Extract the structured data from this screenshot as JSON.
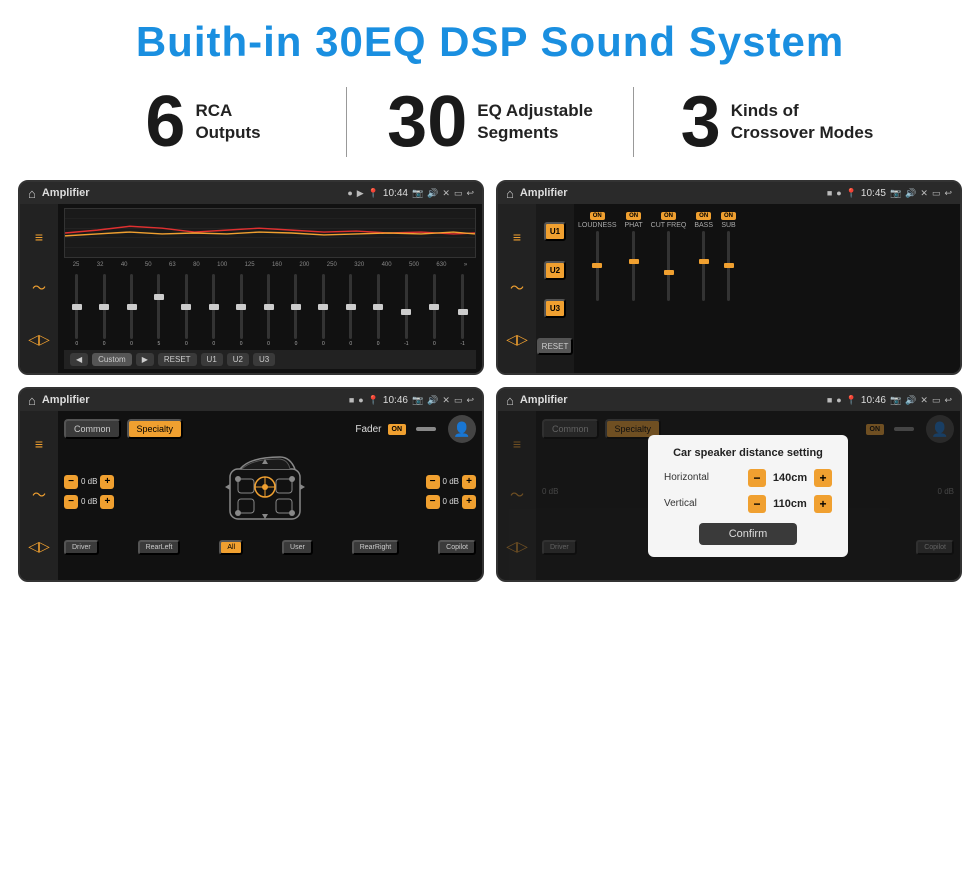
{
  "title": "Buith-in 30EQ DSP Sound System",
  "stats": [
    {
      "number": "6",
      "text": "RCA\nOutputs"
    },
    {
      "number": "30",
      "text": "EQ Adjustable\nSegments"
    },
    {
      "number": "3",
      "text": "Kinds of\nCrossover Modes"
    }
  ],
  "screens": [
    {
      "id": "eq-screen",
      "status_bar": {
        "title": "Amplifier",
        "time": "10:44"
      }
    },
    {
      "id": "amp-screen",
      "status_bar": {
        "title": "Amplifier",
        "time": "10:45"
      }
    },
    {
      "id": "fader-screen",
      "status_bar": {
        "title": "Amplifier",
        "time": "10:46"
      }
    },
    {
      "id": "dialog-screen",
      "status_bar": {
        "title": "Amplifier",
        "time": "10:46"
      },
      "dialog": {
        "title": "Car speaker distance setting",
        "horizontal_label": "Horizontal",
        "horizontal_value": "140cm",
        "vertical_label": "Vertical",
        "vertical_value": "110cm",
        "confirm_label": "Confirm"
      }
    }
  ],
  "eq_freqs": [
    "25",
    "32",
    "40",
    "50",
    "63",
    "80",
    "100",
    "125",
    "160",
    "200",
    "250",
    "320",
    "400",
    "500",
    "630"
  ],
  "eq_values": [
    "0",
    "0",
    "0",
    "5",
    "0",
    "0",
    "0",
    "0",
    "0",
    "0",
    "0",
    "0",
    "-1",
    "0",
    "-1"
  ],
  "amp_channels": [
    {
      "label": "LOUDNESS",
      "on": true
    },
    {
      "label": "PHAT",
      "on": true
    },
    {
      "label": "CUT FREQ",
      "on": true
    },
    {
      "label": "BASS",
      "on": true
    },
    {
      "label": "SUB",
      "on": true
    }
  ],
  "amp_presets": [
    "U1",
    "U2",
    "U3"
  ],
  "fader_tabs": [
    "Common",
    "Specialty"
  ],
  "fader_label": "Fader",
  "fader_bottom_btns": [
    "Driver",
    "RearLeft",
    "All",
    "User",
    "RearRight",
    "Copilot"
  ],
  "dialog_confirm": "Confirm"
}
